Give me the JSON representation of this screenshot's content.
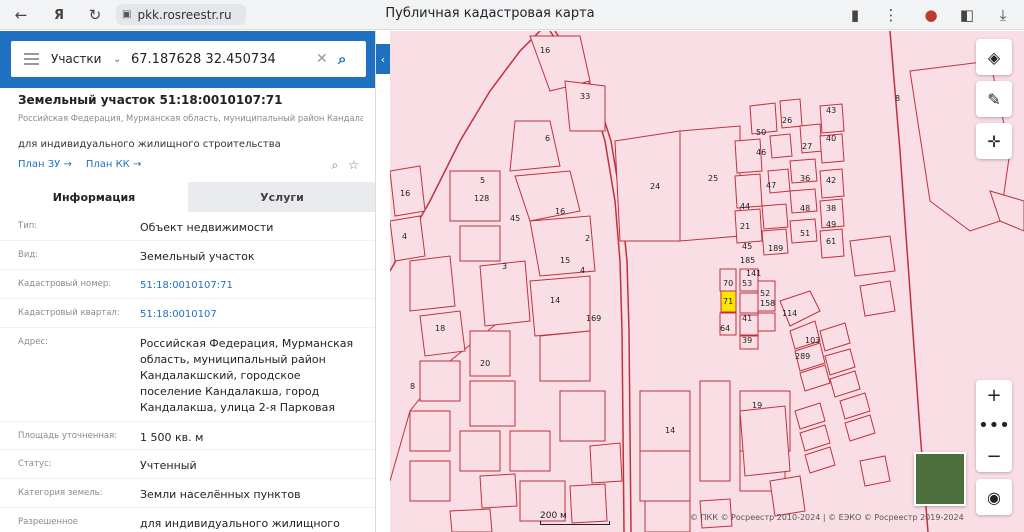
{
  "browser": {
    "url": "pkk.rosreestr.ru",
    "title": "Публичная кадастровая карта"
  },
  "search": {
    "type": "Участки",
    "query": "67.187628 32.450734"
  },
  "object": {
    "title": "Земельный участок 51:18:0010107:71",
    "address_short": "Российская Федерация, Мурманская область, муниципальный район Кандалакшский, городское поселение Кандалакша, город Кандалакша, улица...",
    "use": "для индивидуального жилищного строительства",
    "plan_zu": "План ЗУ →",
    "plan_kk": "План КК →"
  },
  "tabs": {
    "info": "Информация",
    "services": "Услуги"
  },
  "fields": [
    {
      "label": "Тип:",
      "value": "Объект недвижимости"
    },
    {
      "label": "Вид:",
      "value": "Земельный участок"
    },
    {
      "label": "Кадастровый номер:",
      "value": "51:18:0010107:71"
    },
    {
      "label": "Кадастровый квартал:",
      "value": "51:18:0010107"
    },
    {
      "label": "Адрес:",
      "value": "Российская Федерация, Мурманская область, муниципальный район Кандалакшский, городское поселение Кандалакша, город Кандалакша, улица 2-я Парковая"
    },
    {
      "label": "Площадь уточненная:",
      "value": "1 500 кв. м"
    },
    {
      "label": "Статус:",
      "value": "Учтенный"
    },
    {
      "label": "Категория земель:",
      "value": "Земли населённых пунктов"
    },
    {
      "label": "Разрешенное",
      "value": "для индивидуального жилищного"
    }
  ],
  "map": {
    "labels": [
      "16",
      "33",
      "6",
      "24",
      "25",
      "8",
      "5",
      "128",
      "45",
      "16",
      "15",
      "2",
      "4",
      "3",
      "14",
      "169",
      "18",
      "8",
      "20",
      "14",
      "19",
      "70",
      "71",
      "64",
      "41",
      "52",
      "39",
      "53",
      "158",
      "141",
      "114",
      "103",
      "289",
      "40",
      "43",
      "42",
      "50",
      "46",
      "26",
      "27",
      "38",
      "36",
      "44",
      "49",
      "48",
      "47",
      "51",
      "61",
      "21",
      "45",
      "185",
      "189",
      "16",
      "4"
    ],
    "scale": "200 м",
    "copyright": "© ПКК © Росреестр 2010-2024 | © ЕЭКО © Росреестр 2019-2024"
  },
  "colors": {
    "accent": "#1f70c1",
    "parcel_fill": "#f9dfe5",
    "parcel_stroke": "#c0313f",
    "selected": "#ffe600"
  }
}
